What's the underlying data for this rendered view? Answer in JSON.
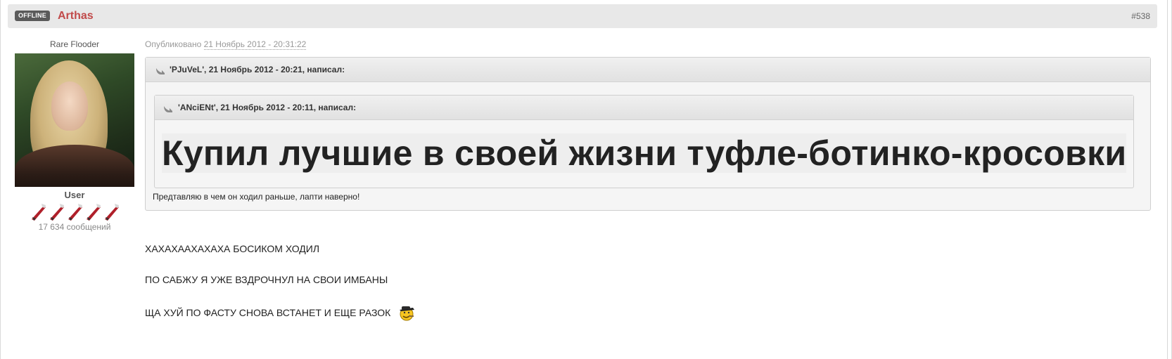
{
  "post": {
    "status": "OFFLINE",
    "author": "Arthas",
    "number": "#538",
    "posted_prefix": "Опубликовано",
    "posted_date": "21 Ноябрь 2012 - 20:31:22"
  },
  "author_panel": {
    "member_title": "Rare Flooder",
    "group": "User",
    "post_count": "17 634 сообщений",
    "rank_pips": 5
  },
  "quote_outer": {
    "citation": "'PJuVeL', 21 Ноябрь 2012 - 20:21, написал:",
    "text": "Предтавляю в чем он ходил раньше, лапти наверно!"
  },
  "quote_inner": {
    "citation": "'ANciENt', 21 Ноябрь 2012 - 20:11, написал:",
    "text": "Купил лучшие в своей жизни туфле-ботинко-кросовки"
  },
  "body": {
    "lines": [
      "ХАХАХААХАХАХА БОСИКОМ ХОДИЛ",
      "ПО САБЖУ Я УЖЕ ВЗДРОЧНУЛ НА СВОИ ИМБАНЫ",
      "ЩА ХУЙ ПО ФАСТУ СНОВА ВСТАНЕТ И ЕЩЕ РАЗОК"
    ],
    "emoticon": "cool-smiley-icon"
  },
  "colors": {
    "author": "#c14a4a",
    "badge_bg": "#5a5a5a",
    "header_bg": "#e8e8e8",
    "quote_bg": "#f5f5f5"
  }
}
